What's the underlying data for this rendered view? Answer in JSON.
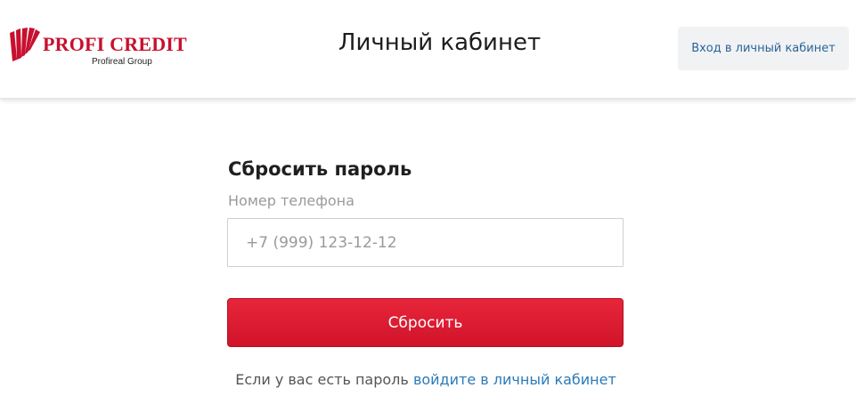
{
  "header": {
    "brand_name": "PROFI CREDIT",
    "brand_subtitle": "Profireal Group",
    "title": "Личный кабинет",
    "login_button": "Вход в личный кабинет"
  },
  "form": {
    "title": "Сбросить пароль",
    "phone_label": "Номер телефона",
    "phone_placeholder": "+7 (999) 123-12-12",
    "phone_value": "",
    "submit_label": "Сбросить"
  },
  "footer": {
    "text": "Если у вас есть пароль",
    "link": "войдите в личный кабинет"
  },
  "colors": {
    "brand_red": "#c8102e",
    "button_red": "#dc1a2f",
    "link_blue": "#2a7ab8"
  }
}
